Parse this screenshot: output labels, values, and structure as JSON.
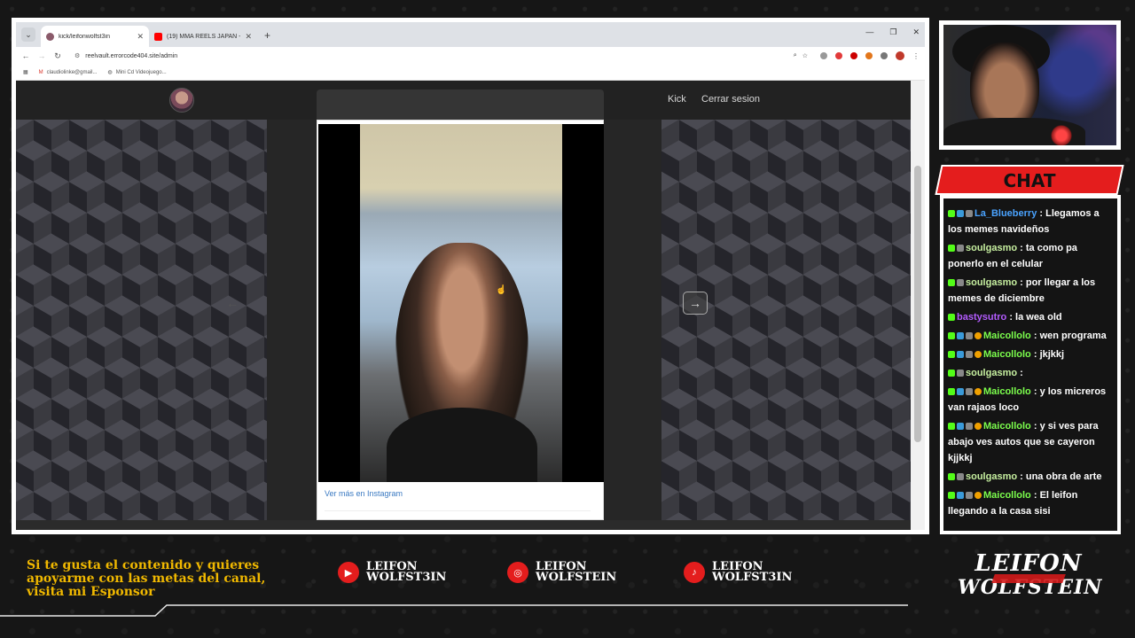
{
  "browser": {
    "tabs": [
      {
        "title": "kick/leifonwolfst3in",
        "active": true,
        "favicon_color": "#8a5a6a"
      },
      {
        "title": "(19) MMA REELS JAPAN - YouTube",
        "active": false,
        "favicon_color": "#ff0000"
      }
    ],
    "url": "reelvault.errorcode404.site/admin",
    "bookmarks": [
      {
        "label": "claudiolinke@gmail..."
      },
      {
        "label": "Mini Cd Videojuego..."
      }
    ]
  },
  "site": {
    "nav": {
      "kick": "Kick",
      "logout": "Cerrar sesion"
    },
    "instagram_link": "Ver más en Instagram"
  },
  "chat": {
    "title": "CHAT",
    "messages": [
      {
        "user": "La_Blueberry",
        "color": "#4aa3ff",
        "text": ": Llegamos a los memes navideños",
        "badges": [
          "k",
          "g",
          "s"
        ]
      },
      {
        "user": "soulgasmo",
        "color": "#c7f0a0",
        "text": ": ta como pa ponerlo en el celular",
        "badges": [
          "k",
          "s"
        ]
      },
      {
        "user": "soulgasmo",
        "color": "#c7f0a0",
        "text": ": por llegar a los memes de diciembre",
        "badges": [
          "k",
          "s"
        ]
      },
      {
        "user": "bastysutro",
        "color": "#b45cff",
        "text": ": la wea old",
        "badges": [
          "k"
        ]
      },
      {
        "user": "Maicollolo",
        "color": "#7cff4d",
        "text": ": wen programa",
        "badges": [
          "k",
          "g",
          "s",
          "o"
        ]
      },
      {
        "user": "Maicollolo",
        "color": "#7cff4d",
        "text": ": jkjkkj",
        "badges": [
          "k",
          "g",
          "s",
          "o"
        ]
      },
      {
        "user": "soulgasmo",
        "color": "#c7f0a0",
        "text": ":",
        "badges": [
          "k",
          "s"
        ]
      },
      {
        "user": "Maicollolo",
        "color": "#7cff4d",
        "text": ": y los micreros van rajaos loco",
        "badges": [
          "k",
          "g",
          "s",
          "o"
        ]
      },
      {
        "user": "Maicollolo",
        "color": "#7cff4d",
        "text": ": y si ves para abajo ves autos que se cayeron kjjkkj",
        "badges": [
          "k",
          "g",
          "s",
          "o"
        ]
      },
      {
        "user": "soulgasmo",
        "color": "#c7f0a0",
        "text": ": una obra de arte",
        "badges": [
          "k",
          "s"
        ]
      },
      {
        "user": "Maicollolo",
        "color": "#7cff4d",
        "text": ": El leifon llegando a la casa sisi",
        "badges": [
          "k",
          "g",
          "s",
          "o"
        ]
      }
    ]
  },
  "overlay": {
    "promo": "Si te gusta el contenido y quieres apoyarme con las metas del canal, visita mi Esponsor",
    "socials": [
      {
        "platform_icon": "youtube-icon",
        "name_line1": "LEIFON",
        "name_line2": "WOLFST3IN"
      },
      {
        "platform_icon": "instagram-icon",
        "name_line1": "LEIFON",
        "name_line2": "WOLFSTEIN"
      },
      {
        "platform_icon": "tiktok-icon",
        "name_line1": "LEIFON",
        "name_line2": "WOLFST3IN"
      }
    ],
    "brand": {
      "line1": "LEIFON",
      "line2": "WOLFSTEIN"
    },
    "accent": "#e41d1d",
    "promo_color": "#f0b800"
  }
}
